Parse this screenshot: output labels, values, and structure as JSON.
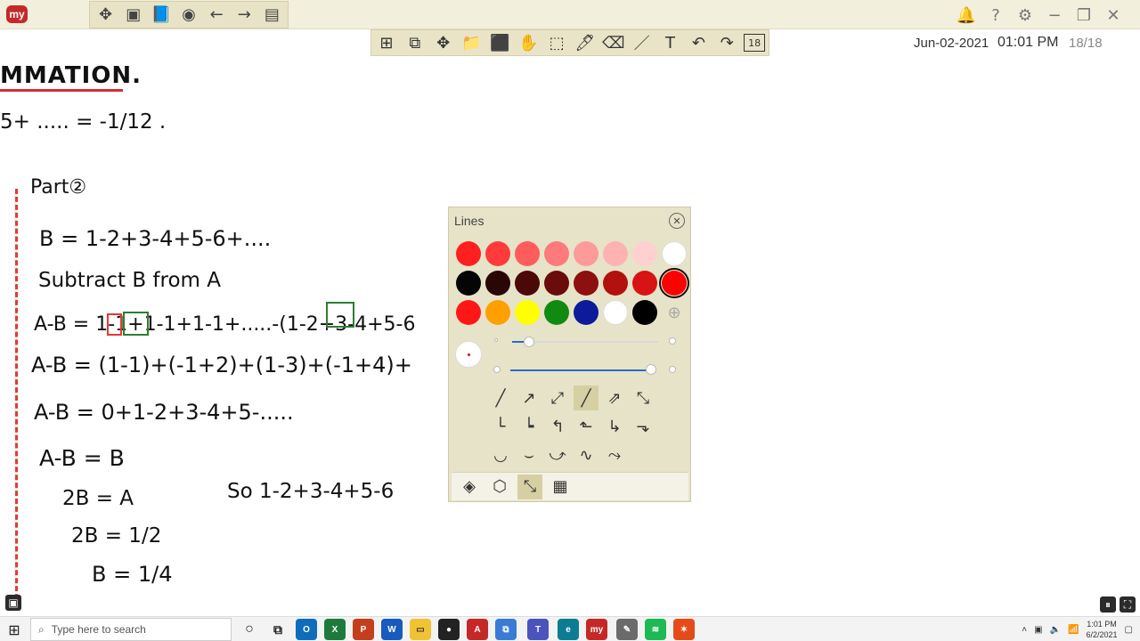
{
  "app": {
    "logo": "my",
    "topbar_icons": [
      "move-icon",
      "whiteboard-icon",
      "book-icon",
      "browser-icon",
      "back-arrow-icon",
      "forward-arrow-icon",
      "new-note-icon"
    ],
    "right_icons": [
      "bell-icon",
      "help-icon",
      "settings-icon",
      "minimize-icon",
      "restore-icon",
      "close-icon"
    ]
  },
  "toolbar": {
    "items": [
      "windows-icon",
      "screenshot-icon",
      "move-icon",
      "folder-icon",
      "box-icon",
      "hand-icon",
      "select-icon",
      "marker-icon",
      "eraser-icon",
      "line-icon",
      "text-icon",
      "undo-icon",
      "redo-icon",
      "page-icon"
    ],
    "page_badge": "18"
  },
  "status": {
    "date": "Jun-02-2021",
    "time": "01:01 PM",
    "page": "18/18"
  },
  "board": {
    "heading": "MMATION.",
    "topline": "5+ ..... = -1/12 .",
    "part_label": "Part②",
    "lines": [
      "B = 1-2+3-4+5-6+....",
      "Subtract B from A",
      "A-B = 1-1+1-1+1-1+.....-(1-2+3-4+5-6",
      "A-B = (1-1)+(-1+2)+(1-3)+(-1+4)+",
      "A-B = 0+1-2+3-4+5-.....",
      "A-B = B",
      "2B = A",
      "2B = 1/2",
      "B = 1/4",
      "So   1-2+3-4+5-6"
    ]
  },
  "lines_panel": {
    "title": "Lines",
    "colors_row1": [
      "#ff1f1f",
      "#ff3b3b",
      "#ff5c5c",
      "#ff7a7a",
      "#ff9a9a",
      "#ffb2b2",
      "#ffd0d0",
      "#ffffff"
    ],
    "colors_row2": [
      "#050505",
      "#2a0704",
      "#4a0906",
      "#6b0c0c",
      "#8e0f0f",
      "#b31010",
      "#d81313",
      "#ff0000"
    ],
    "colors_row3": [
      "#ff1717",
      "#ffa000",
      "#ffff00",
      "#118a11",
      "#0b1b9a",
      "#ffffff",
      "#000000"
    ],
    "selected_color": "#ff0000",
    "line_tools": [
      "line",
      "arrow",
      "double-arrow",
      "dashed-line",
      "dashed-arrow",
      "dashed-double-arrow",
      "elbow",
      "dashed-elbow",
      "elbow-arrow",
      "dashed-elbow-arrow",
      "elbow-arrow-alt",
      "dashed-elbow-arrow-alt",
      "arc",
      "arc-arrow",
      "arc-double-arrow",
      "s-curve",
      "s-curve-arrow"
    ],
    "tabs": [
      "shape-fill-icon",
      "3d-box-icon",
      "line-style-icon",
      "grid-icon"
    ]
  },
  "taskbar": {
    "search_placeholder": "Type here to search",
    "time": "1:01 PM",
    "date": "6/2/2021",
    "apps": [
      "task-view-icon",
      "outlook-icon",
      "excel-icon",
      "powerpoint-icon",
      "word-icon",
      "file-explorer-icon",
      "app-icon",
      "acrobat-icon",
      "remote-desktop-icon",
      "teams-icon",
      "edge-icon",
      "myviewboard-icon",
      "app-2-icon",
      "spotify-icon",
      "app-3-icon"
    ]
  }
}
